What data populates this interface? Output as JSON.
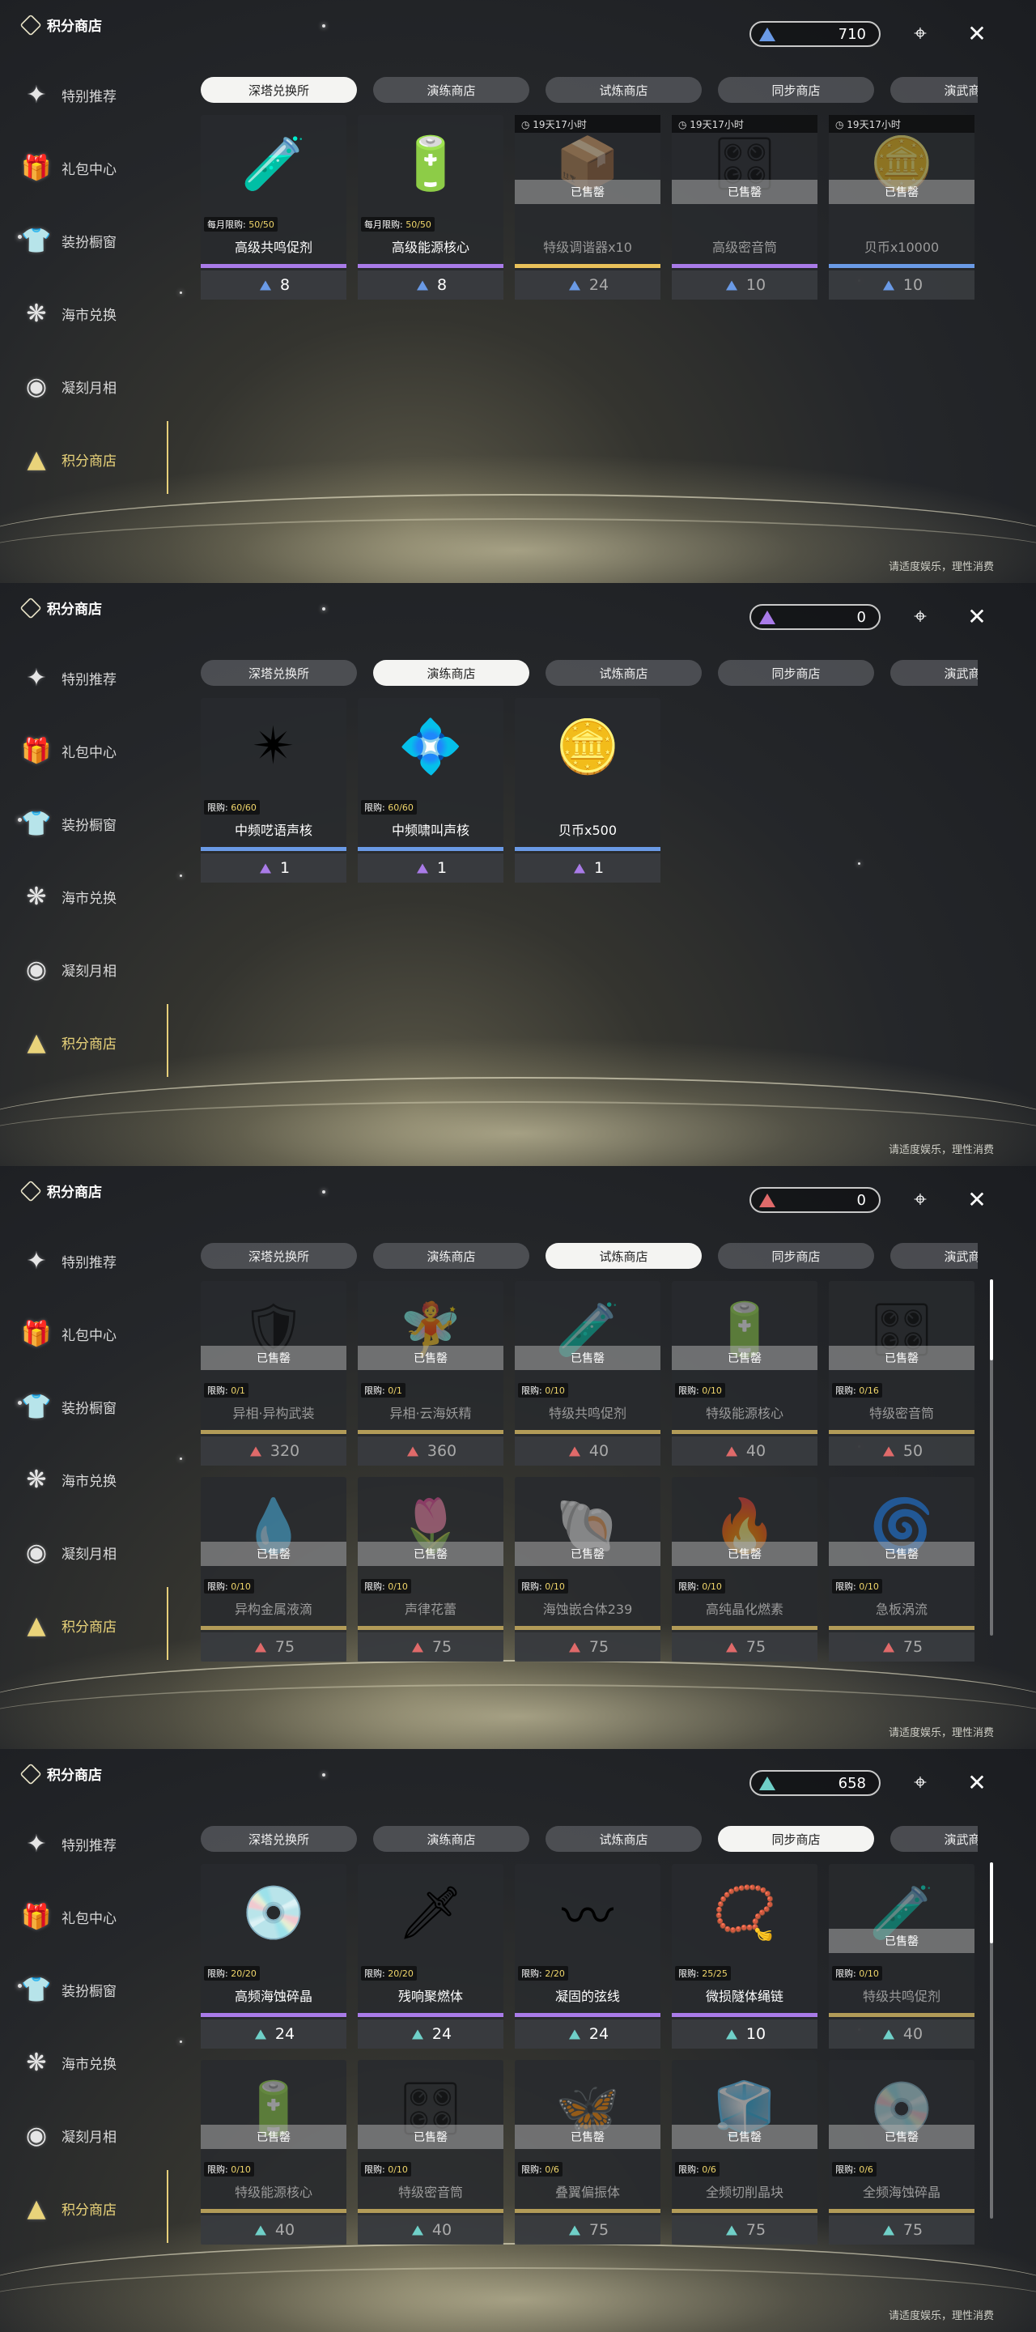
{
  "app_title": "积分商店",
  "sidebar": [
    "特别推荐",
    "礼包中心",
    "装扮橱窗",
    "海市兑换",
    "凝刻月相",
    "积分商店"
  ],
  "sidebar_icons": [
    "gift-spark-icon",
    "gift-box-icon",
    "outfit-icon",
    "tree-icon",
    "moon-orb-icon",
    "triangle-emblem-icon"
  ],
  "tabs": [
    "深塔兑换所",
    "演练商店",
    "试炼商店",
    "同步商店",
    "演武商店"
  ],
  "footer": "请适度娱乐，理性消费",
  "sold_label": "已售罄",
  "colors": {
    "blue": "#6a9ae6",
    "purple": "#a97be8",
    "red": "#e06a6a",
    "teal": "#6fd0c8",
    "accent": "#e9d37a"
  },
  "panels": [
    {
      "active_tab": 0,
      "currency_value": "710",
      "currency_color": "#6a9ae6",
      "items": [
        {
          "name": "高级共鸣促剂",
          "limit_label": "每月限购:",
          "limit": "50/50",
          "price": "8",
          "bar": "#a97be8",
          "glyph": "🧪"
        },
        {
          "name": "高级能源核心",
          "limit_label": "每月限购:",
          "limit": "50/50",
          "price": "8",
          "bar": "#a97be8",
          "glyph": "🔋"
        },
        {
          "name": "特级调谐器x10",
          "timer": "19天17小时",
          "sold": true,
          "price": "24",
          "bar": "#e9c15a",
          "glyph": "📦"
        },
        {
          "name": "高级密音筒",
          "timer": "19天17小时",
          "sold": true,
          "price": "10",
          "bar": "#a97be8",
          "glyph": "🎛"
        },
        {
          "name": "贝币x10000",
          "timer": "19天17小时",
          "sold": true,
          "price": "10",
          "bar": "#6a9ae6",
          "glyph": "🪙"
        }
      ]
    },
    {
      "active_tab": 1,
      "currency_value": "0",
      "currency_color": "#a97be8",
      "items": [
        {
          "name": "中频呓语声核",
          "limit_label": "限购:",
          "limit": "60/60",
          "price": "1",
          "bar": "#6a9ae6",
          "glyph": "✴"
        },
        {
          "name": "中频啸叫声核",
          "limit_label": "限购:",
          "limit": "60/60",
          "price": "1",
          "bar": "#6a9ae6",
          "glyph": "💠"
        },
        {
          "name": "贝币x500",
          "price": "1",
          "bar": "#6a9ae6",
          "glyph": "🪙"
        }
      ]
    },
    {
      "active_tab": 2,
      "currency_value": "0",
      "currency_color": "#e06a6a",
      "items": [
        {
          "name": "异相·异构武装",
          "limit_label": "限购:",
          "limit": "0/1",
          "sold": true,
          "price": "320",
          "glyph": "🛡"
        },
        {
          "name": "异相·云海妖精",
          "limit_label": "限购:",
          "limit": "0/1",
          "sold": true,
          "price": "360",
          "glyph": "🧚"
        },
        {
          "name": "特级共鸣促剂",
          "limit_label": "限购:",
          "limit": "0/10",
          "sold": true,
          "price": "40",
          "glyph": "🧪"
        },
        {
          "name": "特级能源核心",
          "limit_label": "限购:",
          "limit": "0/10",
          "sold": true,
          "price": "40",
          "glyph": "🔋"
        },
        {
          "name": "特级密音筒",
          "limit_label": "限购:",
          "limit": "0/16",
          "sold": true,
          "price": "50",
          "glyph": "🎛"
        },
        {
          "name": "异构金属液滴",
          "limit_label": "限购:",
          "limit": "0/10",
          "sold": true,
          "price": "75",
          "glyph": "💧"
        },
        {
          "name": "声律花蕾",
          "limit_label": "限购:",
          "limit": "0/10",
          "sold": true,
          "price": "75",
          "glyph": "🌷"
        },
        {
          "name": "海蚀嵌合体239",
          "limit_label": "限购:",
          "limit": "0/10",
          "sold": true,
          "price": "75",
          "glyph": "🐚"
        },
        {
          "name": "高纯晶化燃素",
          "limit_label": "限购:",
          "limit": "0/10",
          "sold": true,
          "price": "75",
          "glyph": "🔥"
        },
        {
          "name": "急板涡流",
          "limit_label": "限购:",
          "limit": "0/10",
          "sold": true,
          "price": "75",
          "glyph": "🌀"
        }
      ]
    },
    {
      "active_tab": 3,
      "currency_value": "658",
      "currency_color": "#6fd0c8",
      "items": [
        {
          "name": "高频海蚀碎晶",
          "limit_label": "限购:",
          "limit": "20/20",
          "price": "24",
          "bar": "#a97be8",
          "glyph": "💿"
        },
        {
          "name": "残响聚燃体",
          "limit_label": "限购:",
          "limit": "20/20",
          "price": "24",
          "bar": "#a97be8",
          "glyph": "🗡"
        },
        {
          "name": "凝固的弦线",
          "limit_label": "限购:",
          "limit": "2/20",
          "price": "24",
          "bar": "#a97be8",
          "glyph": "〰"
        },
        {
          "name": "微损隧体绳链",
          "limit_label": "限购:",
          "limit": "25/25",
          "price": "10",
          "bar": "#a97be8",
          "glyph": "📿"
        },
        {
          "name": "特级共鸣促剂",
          "limit_label": "限购:",
          "limit": "0/10",
          "sold": true,
          "price": "40",
          "glyph": "🧪"
        },
        {
          "name": "特级能源核心",
          "limit_label": "限购:",
          "limit": "0/10",
          "sold": true,
          "price": "40",
          "glyph": "🔋"
        },
        {
          "name": "特级密音筒",
          "limit_label": "限购:",
          "limit": "0/10",
          "sold": true,
          "price": "40",
          "glyph": "🎛"
        },
        {
          "name": "叠翼偏振体",
          "limit_label": "限购:",
          "limit": "0/6",
          "sold": true,
          "price": "75",
          "glyph": "🦋"
        },
        {
          "name": "全频切削晶块",
          "limit_label": "限购:",
          "limit": "0/6",
          "sold": true,
          "price": "75",
          "glyph": "🧊"
        },
        {
          "name": "全频海蚀碎晶",
          "limit_label": "限购:",
          "limit": "0/6",
          "sold": true,
          "price": "75",
          "glyph": "💿"
        }
      ]
    }
  ]
}
